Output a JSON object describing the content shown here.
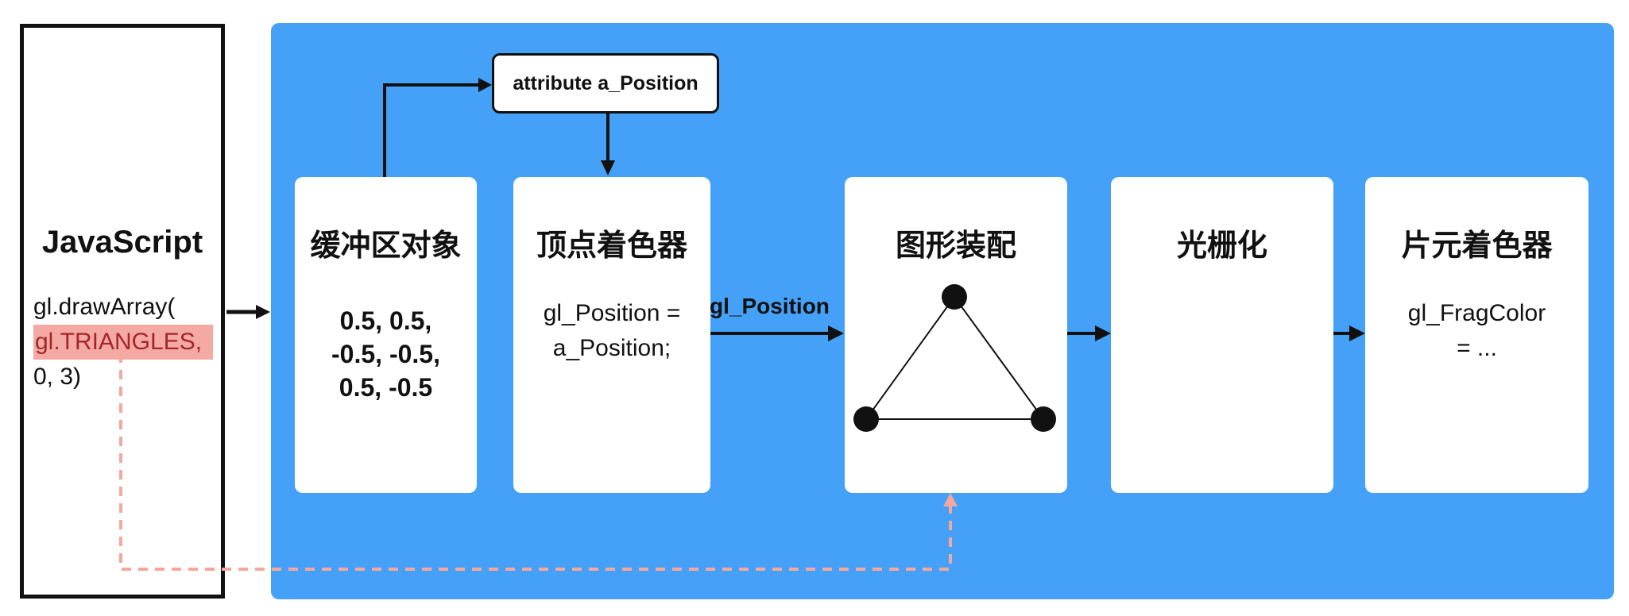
{
  "javascript": {
    "title": "JavaScript",
    "code_line1": "gl.drawArray(",
    "code_line2_highlight": "gl.TRIANGLES,",
    "code_line3": "0, 3)"
  },
  "attribute_box": {
    "label": "attribute a_Position"
  },
  "buffer": {
    "title": "缓冲区对象",
    "line1": "0.5,  0.5,",
    "line2": "-0.5, -0.5,",
    "line3": "0.5, -0.5"
  },
  "vertex_shader": {
    "title": "顶点着色器",
    "line1": "gl_Position =",
    "line2": "a_Position;"
  },
  "edge_gl_position": {
    "label": "gl_Position"
  },
  "assembly": {
    "title": "图形装配"
  },
  "rasterization": {
    "title": "光栅化"
  },
  "fragment_shader": {
    "title": "片元着色器",
    "line1": "gl_FragColor",
    "line2": "= ..."
  },
  "colors": {
    "pipeline_bg": "#44a1f7",
    "card_bg": "#ffffff",
    "highlight_bg": "#f4aaa2",
    "highlight_text": "#a5262a",
    "dashed_connector": "#f4a79d"
  }
}
